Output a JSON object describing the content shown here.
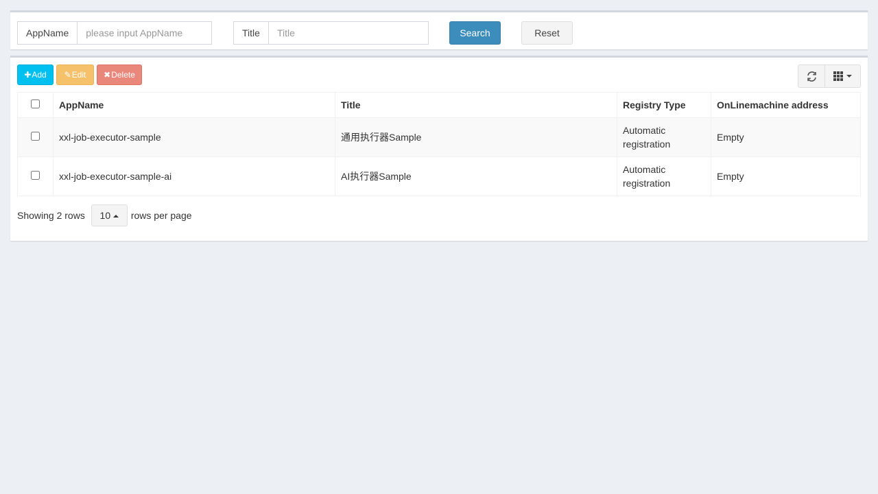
{
  "search": {
    "appname_label": "AppName",
    "appname_placeholder": "please input AppName",
    "appname_value": "",
    "title_label": "Title",
    "title_placeholder": "Title",
    "title_value": "",
    "search_button": "Search",
    "reset_button": "Reset"
  },
  "toolbar": {
    "add_label": "Add",
    "edit_label": "Edit",
    "delete_label": "Delete",
    "add_icon": "plus-icon",
    "edit_icon": "edit-icon",
    "delete_icon": "times-icon",
    "refresh_icon": "refresh-icon",
    "columns_icon": "grid-icon"
  },
  "table": {
    "columns": [
      "AppName",
      "Title",
      "Registry Type",
      "OnLinemachine address"
    ],
    "rows": [
      {
        "appname": "xxl-job-executor-sample",
        "title": "通用执行器Sample",
        "registry_type": "Automatic registration",
        "address": "Empty"
      },
      {
        "appname": "xxl-job-executor-sample-ai",
        "title": "AI执行器Sample",
        "registry_type": "Automatic registration",
        "address": "Empty"
      }
    ]
  },
  "pagination": {
    "showing_text": "Showing 2 rows",
    "page_size": "10",
    "per_page_text": "rows per page"
  },
  "colors": {
    "page_bg": "#ecf0f5",
    "primary": "#3c8dbc",
    "info": "#00c0ef",
    "warning": "#f5c26b",
    "danger": "#e8877a"
  }
}
